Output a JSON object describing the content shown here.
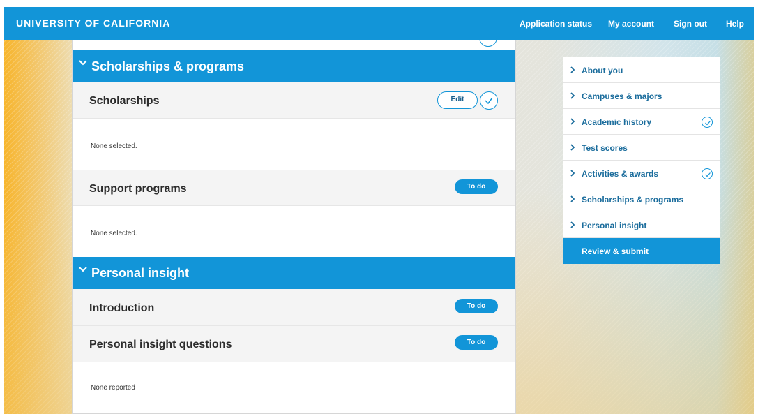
{
  "header": {
    "brand": "UNIVERSITY OF CALIFORNIA",
    "nav": [
      "Application status",
      "My account",
      "Sign out",
      "Help"
    ]
  },
  "sections": {
    "scholarships_programs": {
      "title": "Scholarships & programs",
      "scholarships": {
        "title": "Scholarships",
        "edit_label": "Edit",
        "body": "None selected."
      },
      "support": {
        "title": "Support programs",
        "status": "To do",
        "body": "None selected."
      }
    },
    "personal_insight": {
      "title": "Personal insight",
      "introduction": {
        "title": "Introduction",
        "status": "To do"
      },
      "questions": {
        "title": "Personal insight questions",
        "status": "To do",
        "body": "None reported"
      }
    }
  },
  "sidebar": {
    "items": [
      {
        "label": "About you",
        "completed": false
      },
      {
        "label": "Campuses & majors",
        "completed": false
      },
      {
        "label": "Academic history",
        "completed": true
      },
      {
        "label": "Test scores",
        "completed": false
      },
      {
        "label": "Activities & awards",
        "completed": true
      },
      {
        "label": "Scholarships & programs",
        "completed": false
      },
      {
        "label": "Personal insight",
        "completed": false
      }
    ],
    "active": "Review & submit"
  },
  "colors": {
    "primary": "#1295d8",
    "link": "#1a6c9c"
  }
}
